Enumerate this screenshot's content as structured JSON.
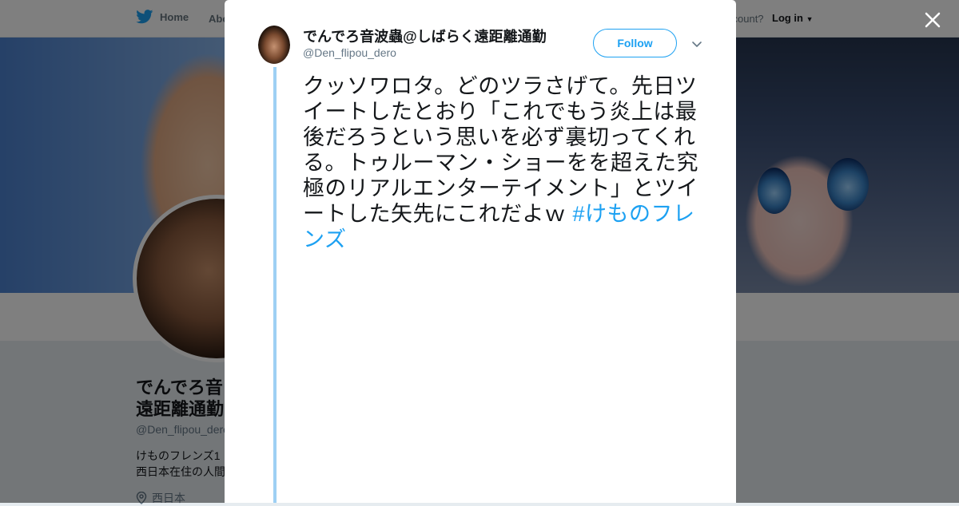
{
  "nav": {
    "home_label": "Home",
    "about_label": "Abo",
    "account_prompt": "ccount?",
    "login_label": "Log in"
  },
  "profile": {
    "name_line1": "でんでろ音",
    "name_line2": "遠距離通勤",
    "handle": "@Den_flipou_dero",
    "bio_line1": "けものフレンズ1",
    "bio_line2": "西日本在住の人間",
    "location": "西日本"
  },
  "tweet": {
    "author_name": "でんでろ音波蟲@しばらく遠距離通勤",
    "author_handle": "@Den_flipou_dero",
    "follow_label": "Follow",
    "text": "クッソワロタ。どのツラさげて。先日ツイートしたとおり「これでもう炎上は最後だろうという思いを必ず裏切ってくれる。トゥルーマン・ショーをを超えた究極のリアルエンターテイメント」とツイートした矢先にこれだよｗ ",
    "hashtag": "#けものフレンズ"
  },
  "colors": {
    "accent": "#1da1f2",
    "thread_line": "#9ed0f4"
  },
  "icons": {
    "brand": "twitter-bird-icon",
    "close": "close-icon",
    "menu": "chevron-down-icon",
    "location": "location-pin-icon"
  }
}
